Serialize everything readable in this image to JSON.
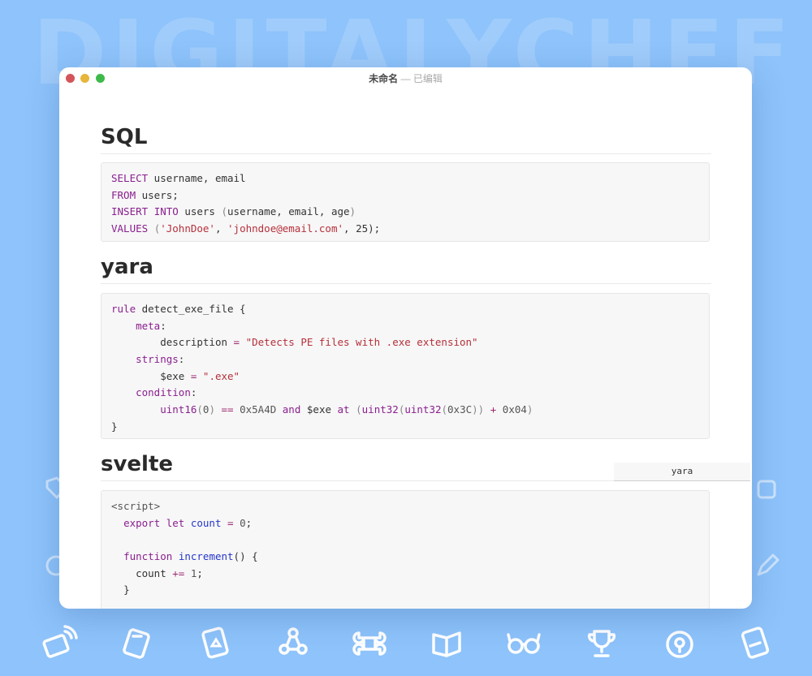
{
  "background": {
    "watermark": "DIGITALYCHEF",
    "color": "#8ec3fb",
    "icons": [
      "wifi-card-icon",
      "tag-icon",
      "badge-icon",
      "network-icon",
      "command-icon",
      "book-icon",
      "glasses-icon",
      "trophy-icon",
      "medal-icon",
      "note-icon"
    ]
  },
  "window": {
    "title": "未命名",
    "separator": "—",
    "status": "已编辑"
  },
  "sections": {
    "sql": {
      "heading": "SQL",
      "code": {
        "l1": {
          "kw1": "SELECT",
          "t1": " username, email"
        },
        "l2": {
          "kw1": "FROM",
          "t1": " users;"
        },
        "l3": {
          "kw1": "INSERT",
          "kw2": "INTO",
          "t1": " users ",
          "p1": "(",
          "t2": "username, email, age",
          "p2": ")"
        },
        "l4": {
          "kw1": "VALUES",
          "p1": "(",
          "s1": "'JohnDoe'",
          "t1": ", ",
          "s2": "'johndoe@email.com'",
          "t2": ", 25);"
        }
      }
    },
    "yara": {
      "heading": "yara",
      "language_label": "yara",
      "code": {
        "l1": {
          "kw1": "rule",
          "t1": " detect_exe_file {"
        },
        "l2": {
          "kw1": "meta",
          "t1": ":"
        },
        "l3": {
          "t1": "description ",
          "o1": "=",
          "s1": "\"Detects PE files with .exe extension\""
        },
        "l4": {
          "kw1": "strings",
          "t1": ":"
        },
        "l5": {
          "t1": "$exe ",
          "o1": "=",
          "s1": "\".exe\""
        },
        "l6": {
          "kw1": "condition",
          "t1": ":"
        },
        "l7": {
          "kw1": "uint16",
          "p1": "(",
          "n1": "0",
          "p2": ")",
          "o1": "==",
          "n2": "0x5A4D",
          "kw2": "and",
          "t1": "$exe",
          "kw3": "at",
          "p3": "(",
          "kw4": "uint32",
          "p4": "(",
          "kw5": "uint32",
          "p5": "(",
          "n3": "0x3C",
          "p6": "))",
          "o2": "+",
          "n4": "0x04",
          "p7": ")"
        },
        "l8": {
          "t1": "}"
        }
      }
    },
    "svelte": {
      "heading": "svelte",
      "code": {
        "l1": {
          "t1": "<script>"
        },
        "l2": {
          "kw1": "export",
          "kw2": "let",
          "f1": "count",
          "o1": "=",
          "n1": "0",
          "t1": ";"
        },
        "l4": {
          "kw1": "function",
          "f1": "increment",
          "t1": "() {"
        },
        "l5": {
          "t1": "count ",
          "o1": "+=",
          "n1": "1",
          "t2": ";"
        },
        "l6": {
          "t1": "}"
        }
      }
    }
  }
}
